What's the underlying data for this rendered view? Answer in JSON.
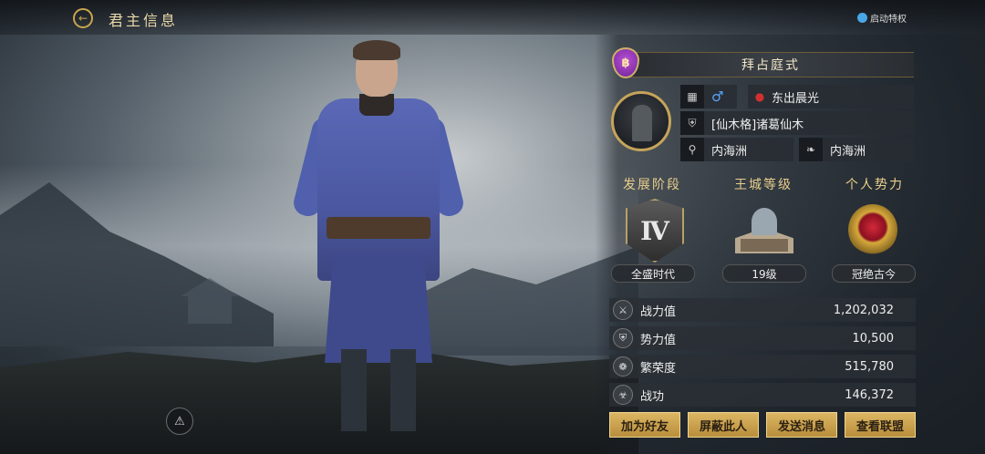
{
  "header": {
    "title": "君主信息",
    "privilege_label": "启动特权"
  },
  "profile": {
    "civilization": "拜占庭式",
    "gender_symbol": "♂",
    "server_name": "东出晨光",
    "alliance": "[仙木格]诸葛仙木",
    "location": "内海洲",
    "origin": "内海洲"
  },
  "sections": {
    "stage_title": "发展阶段",
    "stage_value": "全盛时代",
    "stage_numeral": "Ⅳ",
    "city_title": "王城等级",
    "city_value": "19级",
    "power_title": "个人势力",
    "power_value": "冠绝古今"
  },
  "stats": [
    {
      "label": "战力值",
      "value": "1,202,032",
      "icon": "combat-power-icon"
    },
    {
      "label": "势力值",
      "value": "10,500",
      "icon": "influence-icon"
    },
    {
      "label": "繁荣度",
      "value": "515,780",
      "icon": "prosperity-icon"
    },
    {
      "label": "战功",
      "value": "146,372",
      "icon": "merit-icon"
    }
  ],
  "actions": {
    "add_friend": "加为好友",
    "block": "屏蔽此人",
    "message": "发送消息",
    "view_alliance": "查看联盟"
  },
  "colors": {
    "accent_gold": "#c9a64e",
    "button_gold": "#dcb663",
    "civ_purple": "#b64fd6"
  }
}
